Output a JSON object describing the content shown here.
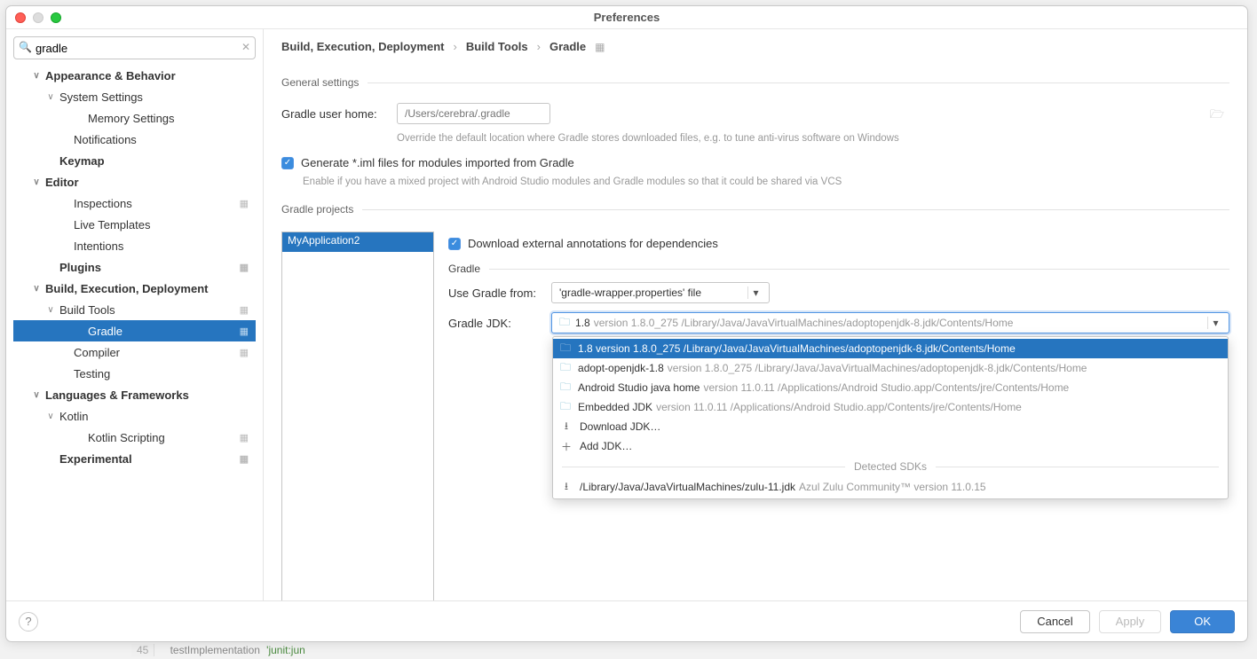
{
  "titlebar": {
    "title": "Preferences"
  },
  "search": {
    "value": "gradle"
  },
  "sidebar": [
    {
      "t": "Appearance & Behavior",
      "bold": true,
      "chev": "∨",
      "d": 1
    },
    {
      "t": "System Settings",
      "bold": false,
      "chev": "∨",
      "d": 2
    },
    {
      "t": "Memory Settings",
      "bold": false,
      "chev": "",
      "d": 4
    },
    {
      "t": "Notifications",
      "bold": false,
      "chev": "",
      "d": 3
    },
    {
      "t": "Keymap",
      "bold": true,
      "chev": "",
      "d": 2
    },
    {
      "t": "Editor",
      "bold": true,
      "chev": "∨",
      "d": 1
    },
    {
      "t": "Inspections",
      "bold": false,
      "chev": "",
      "d": 3,
      "gear": true
    },
    {
      "t": "Live Templates",
      "bold": false,
      "chev": "",
      "d": 3
    },
    {
      "t": "Intentions",
      "bold": false,
      "chev": "",
      "d": 3
    },
    {
      "t": "Plugins",
      "bold": true,
      "chev": "",
      "d": 2,
      "gear": true
    },
    {
      "t": "Build, Execution, Deployment",
      "bold": true,
      "chev": "∨",
      "d": 1
    },
    {
      "t": "Build Tools",
      "bold": false,
      "chev": "∨",
      "d": 2,
      "gear": true
    },
    {
      "t": "Gradle",
      "bold": false,
      "chev": "",
      "d": 4,
      "sel": true,
      "gear": true
    },
    {
      "t": "Compiler",
      "bold": false,
      "chev": "",
      "d": 3,
      "gear": true
    },
    {
      "t": "Testing",
      "bold": false,
      "chev": "",
      "d": 3
    },
    {
      "t": "Languages & Frameworks",
      "bold": true,
      "chev": "∨",
      "d": 1
    },
    {
      "t": "Kotlin",
      "bold": false,
      "chev": "∨",
      "d": 2
    },
    {
      "t": "Kotlin Scripting",
      "bold": false,
      "chev": "",
      "d": 4,
      "gear": true
    },
    {
      "t": "Experimental",
      "bold": true,
      "chev": "",
      "d": 2,
      "gear": true
    }
  ],
  "breadcrumb": [
    "Build, Execution, Deployment",
    "Build Tools",
    "Gradle"
  ],
  "sections": {
    "general": "General settings",
    "projects": "Gradle projects",
    "gradle": "Gradle"
  },
  "general": {
    "home_label": "Gradle user home:",
    "home_placeholder": "/Users/cerebra/.gradle",
    "home_hint": "Override the default location where Gradle stores downloaded files, e.g. to tune anti-virus software on Windows",
    "iml_label": "Generate *.iml files for modules imported from Gradle",
    "iml_hint": "Enable if you have a mixed project with Android Studio modules and Gradle modules so that it could be shared via VCS"
  },
  "project": {
    "items": [
      "MyApplication2"
    ],
    "download_annotations": "Download external annotations for dependencies",
    "use_from_label": "Use Gradle from:",
    "use_from_value": "'gradle-wrapper.properties' file",
    "jdk_label": "Gradle JDK:",
    "jdk_value_main": "1.8",
    "jdk_value_detail": "version 1.8.0_275 /Library/Java/JavaVirtualMachines/adoptopenjdk-8.jdk/Contents/Home"
  },
  "dropdown": {
    "items": [
      {
        "icon": "folder",
        "main": "1.8 version 1.8.0_275 /Library/Java/JavaVirtualMachines/adoptopenjdk-8.jdk/Contents/Home",
        "light": "",
        "sel": true
      },
      {
        "icon": "folder",
        "main": "adopt-openjdk-1.8",
        "light": "version 1.8.0_275 /Library/Java/JavaVirtualMachines/adoptopenjdk-8.jdk/Contents/Home"
      },
      {
        "icon": "folder",
        "main": "Android Studio java home",
        "light": "version 11.0.11 /Applications/Android Studio.app/Contents/jre/Contents/Home"
      },
      {
        "icon": "folder",
        "main": "Embedded JDK",
        "light": "version 11.0.11 /Applications/Android Studio.app/Contents/jre/Contents/Home"
      },
      {
        "icon": "download",
        "main": "Download JDK…",
        "light": ""
      },
      {
        "icon": "add",
        "main": "Add JDK…",
        "light": ""
      }
    ],
    "sep_header": "Detected SDKs",
    "detected": [
      {
        "main": "/Library/Java/JavaVirtualMachines/zulu-11.jdk",
        "light": "Azul Zulu Community™ version 11.0.15"
      }
    ]
  },
  "footer": {
    "cancel": "Cancel",
    "apply": "Apply",
    "ok": "OK"
  },
  "bgcode": {
    "ln": "45",
    "kw": "testImplementation",
    "str": "'junit:jun"
  }
}
